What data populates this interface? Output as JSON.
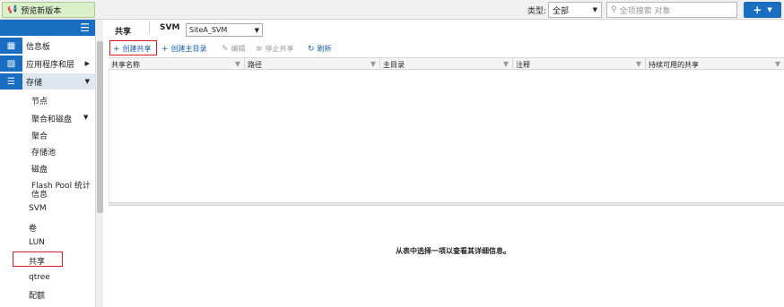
{
  "topbar": {
    "preview_label": "预览新版本",
    "type_label": "类型:",
    "type_value": "全部",
    "search_placeholder": "全项搜索 对象",
    "add_label": "+"
  },
  "nav": {
    "items": [
      {
        "label": "信息板",
        "icon": "dashboard-icon"
      },
      {
        "label": "应用程序和层",
        "icon": "apps-icon",
        "expandable": true
      },
      {
        "label": "存储",
        "icon": "storage-icon",
        "expandable": true,
        "expanded": true
      }
    ],
    "storage_children": [
      {
        "label": "节点"
      },
      {
        "label": "聚合和磁盘",
        "expandable": true
      },
      {
        "label": "聚合",
        "indent": 2
      },
      {
        "label": "存储池",
        "indent": 2
      },
      {
        "label": "磁盘",
        "indent": 2
      },
      {
        "label": "Flash Pool 统计",
        "indent": 2
      },
      {
        "label": "信息",
        "indent": 2
      },
      {
        "label": "SVM"
      },
      {
        "label": "卷"
      },
      {
        "label": "LUN"
      },
      {
        "label": "共享",
        "selected": true
      },
      {
        "label": "qtree"
      },
      {
        "label": "配额"
      }
    ]
  },
  "main": {
    "title": "共享",
    "svm_label": "SVM",
    "svm_value": "SiteA_SVM",
    "actions": [
      {
        "label": "创建共享",
        "icon": "+",
        "enabled": true
      },
      {
        "label": "创建主目录",
        "icon": "+",
        "enabled": true
      },
      {
        "label": "编辑",
        "icon": "✎",
        "enabled": false
      },
      {
        "label": "停止共享",
        "icon": "≡",
        "enabled": false
      },
      {
        "label": "刷新",
        "icon": "↻",
        "enabled": true
      }
    ],
    "columns": [
      "共享名称",
      "路径",
      "主目录",
      "注释",
      "持续可用的共享"
    ],
    "detail_message": "从表中选择一项以查看其详细信息。"
  },
  "colors": {
    "accent": "#1a6ec2",
    "highlight": "#e02020",
    "preview_bg": "#d9f0c8"
  }
}
